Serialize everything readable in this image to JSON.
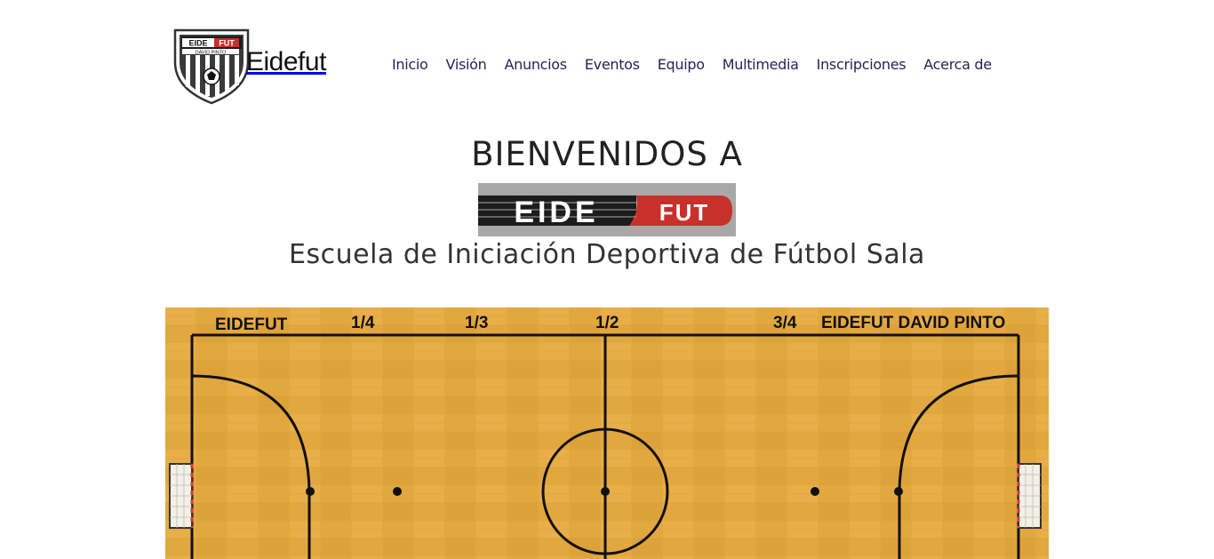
{
  "brand": {
    "name": "Eidefut",
    "crest_top_text": "EIDE FUT",
    "crest_sub_text": "DAVID PINTO"
  },
  "nav": {
    "items": [
      {
        "label": "Inicio"
      },
      {
        "label": "Visión"
      },
      {
        "label": "Anuncios"
      },
      {
        "label": "Eventos"
      },
      {
        "label": "Equipo"
      },
      {
        "label": "Multimedia"
      },
      {
        "label": "Inscripciones"
      },
      {
        "label": "Acerca de"
      }
    ]
  },
  "hero": {
    "title": "BIENVENIDOS A",
    "logo_text_left": "EIDE",
    "logo_text_right": "FUT",
    "subtitle": "Escuela de Iniciación Deportiva de Fútbol Sala"
  },
  "court": {
    "label_left": "EIDEFUT",
    "label_quarter": "1/4",
    "label_third": "1/3",
    "label_half": "1/2",
    "label_three_quarter": "3/4",
    "label_right": "EIDEFUT DAVID PINTO"
  },
  "colors": {
    "nav_text": "#2a1f55",
    "wood": "#e3a740",
    "logo_red": "#c8302c",
    "logo_gray": "#a8a8a8"
  }
}
